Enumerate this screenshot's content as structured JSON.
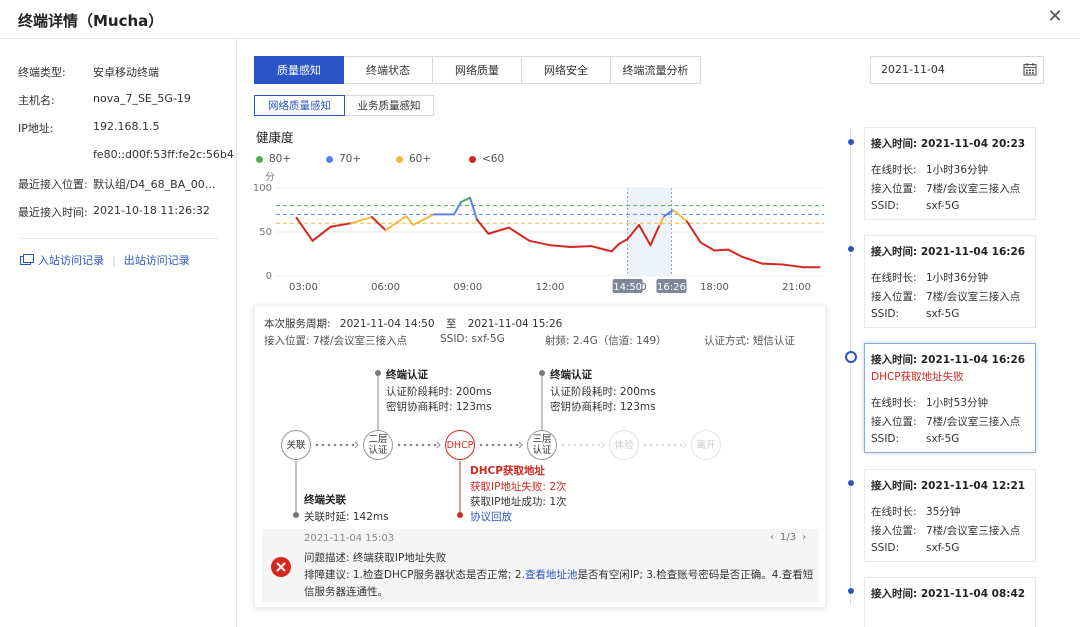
{
  "modal": {
    "title": "终端详情（Mucha）",
    "close_glyph": "✕"
  },
  "info": {
    "rows": [
      {
        "label": "终端类型:",
        "value": "安卓移动终端"
      },
      {
        "label": "主机名:",
        "value": "nova_7_SE_5G-19"
      },
      {
        "label": "IP地址:",
        "value": "192.168.1.5"
      },
      {
        "label": "",
        "value": "fe80::d00f:53ff:fe2c:56b4"
      },
      {
        "label": "最近接入位置:",
        "value": "默认组/D4_68_BA_00..."
      },
      {
        "label": "最近接入时间:",
        "value": "2021-10-18 11:26:32"
      }
    ],
    "links": {
      "in_label": "入站访问记录",
      "separator": "|",
      "out_label": "出站访问记录"
    }
  },
  "tabs": [
    "质量感知",
    "终端状态",
    "网络质量",
    "网络安全",
    "终端流量分析"
  ],
  "subtabs": [
    "网络质量感知",
    "业务质量感知"
  ],
  "date_picker": {
    "value": "2021-11-04"
  },
  "health": {
    "title": "健康度",
    "y_unit": "分",
    "legend": [
      {
        "label": "80+",
        "color": "#4caf50"
      },
      {
        "label": "70+",
        "color": "#5b82e6"
      },
      {
        "label": "60+",
        "color": "#f5b942"
      },
      {
        "label": "<60",
        "color": "#d4281f"
      }
    ]
  },
  "chart_data": {
    "type": "line",
    "title": "健康度",
    "ylabel": "分",
    "ylim": [
      0,
      100
    ],
    "yticks": [
      "100",
      "50",
      "0"
    ],
    "x_ticks": [
      "03:00",
      "06:00",
      "09:00",
      "12:00",
      "15:00",
      "18:00",
      "21:00"
    ],
    "xlim": [
      "2021-11-04 02:00",
      "2021-11-04 22:00"
    ],
    "highlight_labels": [
      "14:50",
      "16:26"
    ],
    "highlight_range": [
      "2021-11-04 14:50",
      "2021-11-04 16:26"
    ],
    "thresholds": [
      {
        "value": 80,
        "color": "#4caf50"
      },
      {
        "value": 70,
        "color": "#5b82e6"
      },
      {
        "value": 60,
        "color": "#f5b942"
      }
    ],
    "series": [
      {
        "x": [
          "02:45",
          "03:20",
          "04:00",
          "04:45",
          "05:30",
          "06:00",
          "06:45",
          "07:00",
          "07:45",
          "08:30",
          "08:45",
          "09:05",
          "09:20",
          "09:45",
          "10:30",
          "11:15",
          "12:00",
          "12:45",
          "13:30",
          "14:00",
          "14:15",
          "14:30",
          "14:50",
          "15:15",
          "15:40",
          "16:00",
          "16:10",
          "16:30",
          "17:00",
          "17:30",
          "18:00",
          "18:30",
          "19:00",
          "19:45",
          "20:30",
          "21:15",
          "21:50"
        ],
        "y": [
          66,
          40,
          56,
          60,
          67,
          52,
          68,
          58,
          70,
          70,
          84,
          89,
          64,
          48,
          55,
          40,
          35,
          33,
          34,
          30,
          28,
          36,
          42,
          58,
          35,
          58,
          68,
          75,
          62,
          38,
          29,
          30,
          22,
          14,
          13,
          10,
          10
        ]
      }
    ]
  },
  "service": {
    "period_label": "本次服务周期:",
    "period_start": "2021-11-04 14:50",
    "period_to": "至",
    "period_end": "2021-11-04 15:26",
    "location": "接入位置: 7楼/会议室三接入点",
    "ssid": "SSID: sxf-5G",
    "radio": "射频: 2.4G（信道: 149）",
    "auth": "认证方式: 短信认证"
  },
  "flow": {
    "nodes": [
      "关联",
      "二层\n认证",
      "DHCP",
      "三层\n认证",
      "体验",
      "离开"
    ],
    "auth1": {
      "title": "终端认证",
      "l1": "认证阶段耗时: 200ms",
      "l2": "密钥协商耗时: 123ms"
    },
    "auth2": {
      "title": "终端认证",
      "l1": "认证阶段耗时: 200ms",
      "l2": "密钥协商耗时: 123ms"
    },
    "assoc": {
      "title": "终端关联",
      "l1": "关联时延: 142ms"
    },
    "dhcp": {
      "title": "DHCP获取地址",
      "fail_label": "获取IP地址失败: ",
      "fail_value": "2次",
      "ok_label": "获取IP地址成功: ",
      "ok_value": "1次",
      "replay": "协议回放"
    }
  },
  "issue": {
    "time": "2021-11-04 15:03",
    "pager": "1/3",
    "desc": "问题描述: 终端获取IP地址失败",
    "advice_a": "排障建议: 1.检查DHCP服务器状态是否正常; 2.",
    "advice_link": "查看地址池",
    "advice_b": "是否有空闲IP; 3.检查账号密码是否正确。4.查看短",
    "advice_c": "信服务器连通性。"
  },
  "timeline": [
    {
      "time_label": "接入时间:",
      "time": "2021-11-04 20:23",
      "error": "",
      "online": "1小时36分钟",
      "location": "7楼/会议室三接入点",
      "ssid": "sxf-5G"
    },
    {
      "time_label": "接入时间:",
      "time": "2021-11-04 16:26",
      "error": "",
      "online": "1小时36分钟",
      "location": "7楼/会议室三接入点",
      "ssid": "sxf-5G"
    },
    {
      "time_label": "接入时间:",
      "time": "2021-11-04 16:26",
      "error": "DHCP获取地址失败",
      "online": "1小时53分钟",
      "location": "7楼/会议室三接入点",
      "ssid": "sxf-5G"
    },
    {
      "time_label": "接入时间:",
      "time": "2021-11-04 12:21",
      "error": "",
      "online": "35分钟",
      "location": "7楼/会议室三接入点",
      "ssid": "sxf-5G"
    },
    {
      "time_label": "接入时间:",
      "time": "2021-11-04 08:42",
      "error": "",
      "online": "",
      "location": "",
      "ssid": ""
    }
  ],
  "timeline_labels": {
    "online": "在线时长:",
    "location": "接入位置:",
    "ssid": "SSID:"
  }
}
